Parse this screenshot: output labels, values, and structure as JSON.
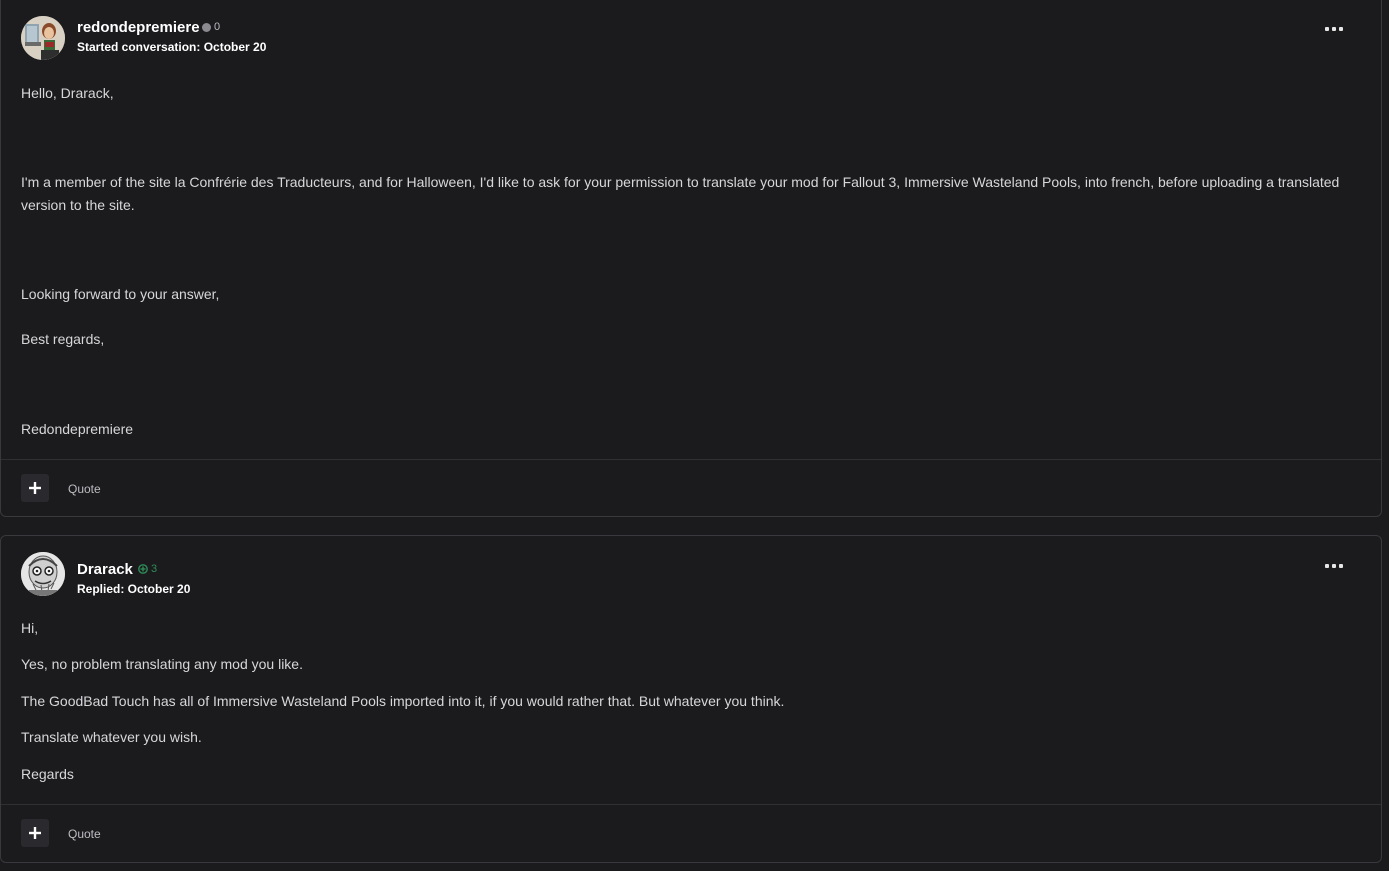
{
  "posts": [
    {
      "username": "redondepremiere",
      "reputation": "0",
      "rep_color": "#8a8a8f",
      "meta": "Started conversation: October 20",
      "paragraphs": [
        "Hello, Drarack,",
        "I'm a member of the site la Confrérie des Traducteurs, and for Halloween, I'd like to ask for your permission to translate your mod for Fallout 3, Immersive Wasteland Pools, into french, before uploading a translated version to the site.",
        "Looking forward to your answer,",
        "Best regards,",
        "Redondepremiere"
      ],
      "plus_icon": "plus-icon",
      "quote_label": "Quote"
    },
    {
      "username": "Drarack",
      "reputation": "3",
      "rep_color": "#2e8b57",
      "meta": "Replied: October 20",
      "paragraphs": [
        "Hi,",
        "Yes, no problem translating any mod you like.",
        "The GoodBad Touch has all of Immersive Wasteland Pools imported into it, if you would rather that. But whatever you think.",
        "Translate whatever you wish.",
        "Regards"
      ],
      "plus_icon": "plus-icon",
      "quote_label": "Quote"
    }
  ]
}
